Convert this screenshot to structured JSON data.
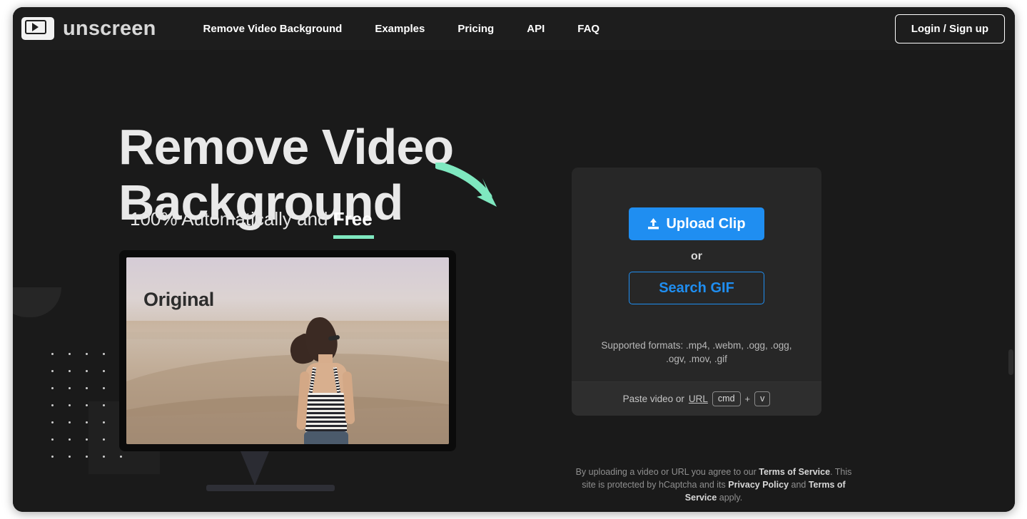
{
  "header": {
    "brand_name": "unscreen",
    "brand_icon": "video-play-icon",
    "nav": [
      {
        "label": "Remove Video Background",
        "name": "nav-remove-video-background"
      },
      {
        "label": "Examples",
        "name": "nav-examples"
      },
      {
        "label": "Pricing",
        "name": "nav-pricing"
      },
      {
        "label": "API",
        "name": "nav-api"
      },
      {
        "label": "FAQ",
        "name": "nav-faq"
      }
    ],
    "login_label": "Login / Sign up"
  },
  "hero": {
    "heading_line1": "Remove Video",
    "heading_line2": "Background",
    "subtitle_prefix": "100% Automatically and ",
    "subtitle_accent": "Free",
    "arrow_icon": "curved-arrow-down-right-icon",
    "preview_badge": "Original"
  },
  "upload_card": {
    "upload_label": "Upload Clip",
    "upload_icon": "upload-icon",
    "or_label": "or",
    "search_gif_label": "Search GIF",
    "supported_formats": "Supported formats: .mp4, .webm, .ogg, .ogg, .ogv, .mov, .gif",
    "paste_prefix": "Paste video or ",
    "paste_link": "URL",
    "key_modifier": "cmd",
    "key_plus": "+",
    "key_letter": "v"
  },
  "legal": {
    "part1": "By uploading a video or URL you agree to our ",
    "link1": "Terms of Service",
    "part2": ". This site is protected by hCaptcha and its ",
    "link2": "Privacy Policy",
    "part3": " and ",
    "link3": "Terms of Service",
    "part4": " apply."
  },
  "colors": {
    "page_bg": "#1a1a1a",
    "header_bg": "#1d1d1d",
    "card_bg": "#272727",
    "accent_blue": "#1f8ef1",
    "accent_mint": "#7fe8c0",
    "text_primary": "#e9e9e9",
    "text_muted": "#8f8f8f"
  }
}
